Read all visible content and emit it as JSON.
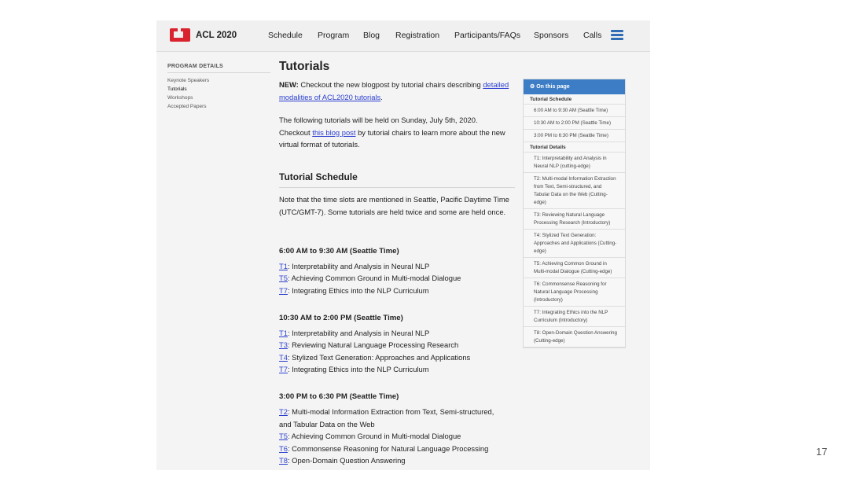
{
  "nav": {
    "brand": "ACL 2020",
    "items": [
      "Schedule",
      "Program",
      "Blog",
      "Registration",
      "Participants/FAQs",
      "Sponsors",
      "Calls"
    ]
  },
  "sidebar": {
    "heading": "PROGRAM DETAILS",
    "items": [
      "Keynote Speakers",
      "Tutorials",
      "Workshops",
      "Accepted Papers"
    ],
    "active": "Tutorials"
  },
  "main": {
    "title": "Tutorials",
    "intro": {
      "new_label": "NEW:",
      "new_text": " Checkout the new blogpost by tutorial chairs describing ",
      "new_link": "detailed modalities of ACL2020 tutorials",
      "new_end": "."
    },
    "para2": {
      "line1": "The following tutorials will be held on Sunday, July 5th, 2020.",
      "pre": "Checkout ",
      "link": "this blog post",
      "post": " by tutorial chairs to learn more about the new virtual format of tutorials."
    },
    "schedule_heading": "Tutorial Schedule",
    "schedule_note": "Note that the time slots are mentioned in Seattle, Pacific Daytime Time (UTC/GMT-7). Some tutorials are held twice and some are held once.",
    "slots": [
      {
        "time": "6:00 AM to 9:30 AM (Seattle Time)",
        "items": [
          {
            "id": "T1",
            "title": ": Interpretability and Analysis in Neural NLP"
          },
          {
            "id": "T5",
            "title": ": Achieving Common Ground in Multi-modal Dialogue"
          },
          {
            "id": "T7",
            "title": ": Integrating Ethics into the NLP Curriculum"
          }
        ]
      },
      {
        "time": "10:30 AM to 2:00 PM (Seattle Time)",
        "items": [
          {
            "id": "T1",
            "title": ": Interpretability and Analysis in Neural NLP"
          },
          {
            "id": "T3",
            "title": ": Reviewing Natural Language Processing Research"
          },
          {
            "id": "T4",
            "title": ": Stylized Text Generation: Approaches and Applications"
          },
          {
            "id": "T7",
            "title": ": Integrating Ethics into the NLP Curriculum"
          }
        ]
      },
      {
        "time": "3:00 PM to 6:30 PM (Seattle Time)",
        "items": [
          {
            "id": "T2",
            "title": ": Multi-modal Information Extraction from Text, Semi-structured,"
          },
          {
            "id": "",
            "title": "and Tabular Data on the Web"
          },
          {
            "id": "T5",
            "title": ": Achieving Common Ground in Multi-modal Dialogue"
          },
          {
            "id": "T6",
            "title": ": Commonsense Reasoning for Natural Language Processing"
          },
          {
            "id": "T8",
            "title": ": Open-Domain Question Answering"
          }
        ]
      }
    ]
  },
  "toc": {
    "heading": "On this page",
    "sections": [
      {
        "label": "Tutorial Schedule",
        "items": [
          "6:00 AM to 9:30 AM (Seattle Time)",
          "10:30 AM to 2:00 PM (Seattle Time)",
          "3:00 PM to 6:30 PM (Seattle Time)"
        ]
      },
      {
        "label": "Tutorial Details",
        "items": [
          "T1: Interpretability and Analysis in Neural NLP (cutting-edge)",
          "T2: Multi-modal Information Extraction from Text, Semi-structured, and Tabular Data on the Web (Cutting-edge)",
          "T3: Reviewing Natural Language Processing Research (Introductory)",
          "T4: Stylized Text Generation: Approaches and Applications (Cutting-edge)",
          "T5: Achieving Common Ground in Multi-modal Dialogue (Cutting-edge)",
          "T6: Commonsense Reasoning for Natural Language Processing (Introductory)",
          "T7: Integrating Ethics into the NLP Curriculum (Introductory)",
          "T8: Open-Domain Question Answering (Cutting-edge)"
        ]
      }
    ]
  },
  "slide": {
    "page_number": "17"
  },
  "colors": {
    "brand_red": "#d9232e",
    "link_blue": "#2b3fcf",
    "toc_header": "#3d7dc6"
  }
}
